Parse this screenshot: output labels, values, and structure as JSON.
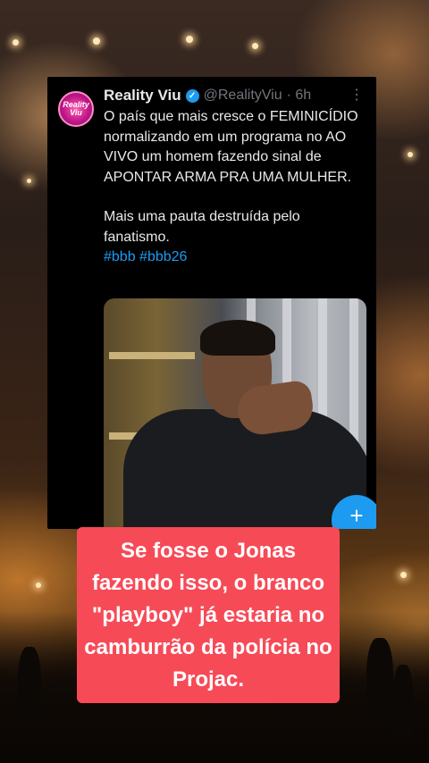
{
  "tweet": {
    "display_name": "Reality Viu",
    "handle": "@RealityViu",
    "time": "· 6h",
    "avatar_text": "Reality Viu",
    "more_icon": "more-icon",
    "verified_icon": "verified-badge-icon",
    "body_line1": "O país que mais cresce o FEMINICÍDIO normalizando em um programa no AO VIVO um homem fazendo sinal de APONTAR ARMA PRA UMA MULHER.",
    "body_line2": "Mais uma pauta destruída pelo fanatismo.",
    "hashtags": "#bbb #bbb26",
    "fab_icon": "plus-icon",
    "fab_label": "+"
  },
  "caption": {
    "text": "Se fosse o Jonas fazendo isso, o branco \"playboy\" já estaria no camburrão da polícia no Projac."
  },
  "colors": {
    "tweet_bg": "#000000",
    "link": "#1d9bf0",
    "caption_bg": "#f74a57"
  }
}
